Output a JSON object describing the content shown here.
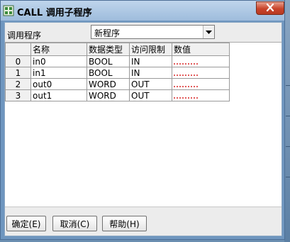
{
  "window": {
    "title": "CALL 调用子程序",
    "close_icon": "close-x-icon",
    "app_icon": "ladder-program-icon",
    "colors": {
      "frame": "#6f96bf",
      "title_gradient_top": "#bfd5ec",
      "close": "#c8432a"
    }
  },
  "program_select": {
    "label": "调用程序",
    "value": "新程序"
  },
  "table": {
    "headers": [
      "",
      "名称",
      "数据类型",
      "访问限制",
      "数值"
    ],
    "rows": [
      {
        "index": "0",
        "name": "in0",
        "type": "BOOL",
        "access": "IN",
        "value": ""
      },
      {
        "index": "1",
        "name": "in1",
        "type": "BOOL",
        "access": "IN",
        "value": ""
      },
      {
        "index": "2",
        "name": "out0",
        "type": "WORD",
        "access": "OUT",
        "value": ""
      },
      {
        "index": "3",
        "name": "out1",
        "type": "WORD",
        "access": "OUT",
        "value": ""
      }
    ]
  },
  "buttons": {
    "ok": "确定(E)",
    "cancel": "取消(C)",
    "help": "帮助(H)"
  }
}
